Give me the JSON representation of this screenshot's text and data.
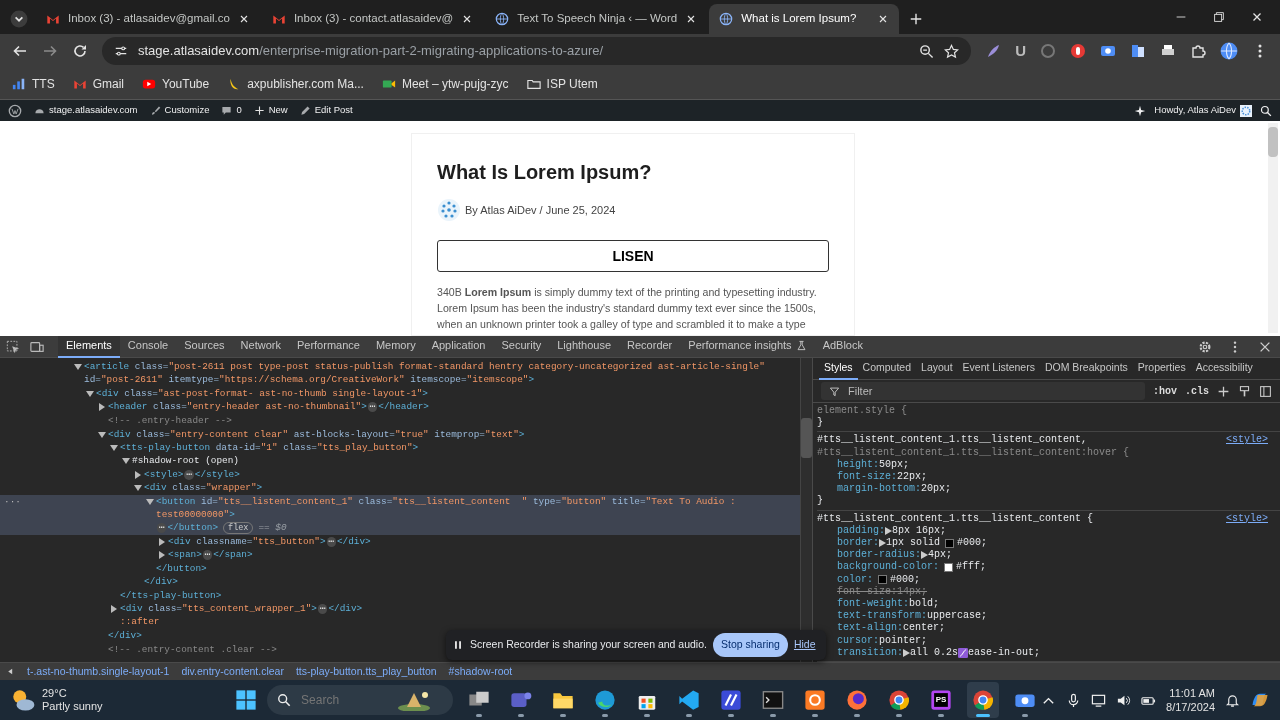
{
  "browser": {
    "tabs": [
      {
        "kind": "gmail",
        "title": "Inbox (3) - atlasaidev@gmail.co",
        "selected": false
      },
      {
        "kind": "gmail",
        "title": "Inbox (3) - contact.atlasaidev@",
        "selected": false
      },
      {
        "kind": "globe",
        "title": "Text To Speech Ninja ‹ — Word",
        "selected": false
      },
      {
        "kind": "globe",
        "title": "What is Lorem Ipsum?",
        "selected": true
      }
    ]
  },
  "toolbar": {
    "url_host": "stage.atlasaidev.com",
    "url_path": "/enterprise-migration-part-2-migrating-applications-to-azure/",
    "extensions": [
      {
        "kind": "feather"
      },
      {
        "kind": "letter",
        "glyph": "U"
      },
      {
        "kind": "ring"
      },
      {
        "kind": "hand"
      },
      {
        "kind": "record"
      },
      {
        "kind": "doc"
      },
      {
        "kind": "printer"
      },
      {
        "kind": "puzzle"
      }
    ]
  },
  "bookmarks": [
    {
      "kind": "bars",
      "label": "TTS"
    },
    {
      "kind": "gmail",
      "label": "Gmail"
    },
    {
      "kind": "youtube",
      "label": "YouTube"
    },
    {
      "kind": "banana",
      "label": "axpublisher.com Ma..."
    },
    {
      "kind": "meet",
      "label": "Meet – ytw-pujg-zyc"
    },
    {
      "kind": "folder",
      "label": "ISP Utem"
    }
  ],
  "admin_bar": {
    "items": [
      {
        "kind": "gauge",
        "label": "stage.atlasaidev.com"
      },
      {
        "kind": "brush",
        "label": "Customize"
      },
      {
        "kind": "comment",
        "label": "0"
      },
      {
        "kind": "plus",
        "label": "New"
      },
      {
        "kind": "pencil",
        "label": "Edit Post"
      }
    ],
    "greeting": "Howdy, Atlas AiDev"
  },
  "post": {
    "title": "What Is Lorem Ipsum?",
    "byline": "By Atlas AiDev / June 25, 2024",
    "listen_button": "LISEN",
    "body": "340B **Lorem Ipsum** is simply dummy text of the printing and typesetting industry. Lorem Ipsum has been the industry's standard dummy text ever since the 1500s, when an unknown printer took a galley of type and scrambled it to make a type"
  },
  "devtools": {
    "tabs": [
      {
        "label": "Elements",
        "selected": true
      },
      {
        "label": "Console",
        "selected": false
      },
      {
        "label": "Sources",
        "selected": false
      },
      {
        "label": "Network",
        "selected": false
      },
      {
        "label": "Performance",
        "selected": false
      },
      {
        "label": "Memory",
        "selected": false
      },
      {
        "label": "Application",
        "selected": false
      },
      {
        "label": "Security",
        "selected": false
      },
      {
        "label": "Lighthouse",
        "selected": false
      },
      {
        "label": "Recorder",
        "selected": false
      },
      {
        "label": "Performance insights",
        "selected": false,
        "experimental": true
      },
      {
        "label": "AdBlock",
        "selected": false
      }
    ],
    "dom": [
      {
        "kind": "open",
        "selected": false,
        "parts": [
          {
            "kind": "tag",
            "text": "<article"
          },
          {
            "kind": "attr",
            "text": " class="
          },
          {
            "kind": "value",
            "text": "\"post-2611 post type-post status-publish format-standard hentry category-uncategorized ast-article-single\""
          },
          {
            "kind": "attr",
            "text": " id="
          },
          {
            "kind": "value",
            "text": "\"post-2611\""
          },
          {
            "kind": "attr",
            "text": " itemtype="
          },
          {
            "kind": "value",
            "text": "\"https://schema.org/CreativeWork\""
          },
          {
            "kind": "attr",
            "text": " itemscope="
          },
          {
            "kind": "value",
            "text": "\"itemscope\""
          },
          {
            "kind": "tag",
            "text": ">"
          }
        ],
        "children": [
          {
            "kind": "open",
            "selected": false,
            "parts": [
              {
                "kind": "tag",
                "text": "<div"
              },
              {
                "kind": "attr",
                "text": " class="
              },
              {
                "kind": "value",
                "text": "\"ast-post-format- ast-no-thumb single-layout-1\""
              },
              {
                "kind": "tag",
                "text": ">"
              }
            ],
            "children": [
              {
                "kind": "closed",
                "selected": false,
                "parts": [
                  {
                    "kind": "tag",
                    "text": "<header"
                  },
                  {
                    "kind": "attr",
                    "text": " class="
                  },
                  {
                    "kind": "value",
                    "text": "\"entry-header ast-no-thumbnail\""
                  },
                  {
                    "kind": "tag",
                    "text": ">"
                  },
                  {
                    "kind": "ellipsis",
                    "text": "⋯"
                  },
                  {
                    "kind": "tag",
                    "text": "</header>"
                  }
                ]
              },
              {
                "kind": "leaf",
                "selected": false,
                "parts": [
                  {
                    "kind": "comment",
                    "text": "<!-- .entry-header -->"
                  }
                ]
              },
              {
                "kind": "open",
                "selected": false,
                "parts": [
                  {
                    "kind": "tag",
                    "text": "<div"
                  },
                  {
                    "kind": "attr",
                    "text": " class="
                  },
                  {
                    "kind": "value",
                    "text": "\"entry-content clear\""
                  },
                  {
                    "kind": "attr",
                    "text": " ast-blocks-layout="
                  },
                  {
                    "kind": "value",
                    "text": "\"true\""
                  },
                  {
                    "kind": "attr",
                    "text": " itemprop="
                  },
                  {
                    "kind": "value",
                    "text": "\"text\""
                  },
                  {
                    "kind": "tag",
                    "text": ">"
                  }
                ],
                "children": [
                  {
                    "kind": "open",
                    "selected": false,
                    "parts": [
                      {
                        "kind": "tag",
                        "text": "<tts-play-button"
                      },
                      {
                        "kind": "attr",
                        "text": " data-id="
                      },
                      {
                        "kind": "value",
                        "text": "\"1\""
                      },
                      {
                        "kind": "attr",
                        "text": " class="
                      },
                      {
                        "kind": "value",
                        "text": "\"tts_play_button\""
                      },
                      {
                        "kind": "tag",
                        "text": ">"
                      }
                    ],
                    "children": [
                      {
                        "kind": "open",
                        "selected": false,
                        "parts": [
                          {
                            "kind": "text",
                            "text": "#shadow-root (open)"
                          }
                        ],
                        "children": [
                          {
                            "kind": "closed",
                            "selected": false,
                            "parts": [
                              {
                                "kind": "tag",
                                "text": "<style>"
                              },
                              {
                                "kind": "ellipsis",
                                "text": "⋯"
                              },
                              {
                                "kind": "tag",
                                "text": "</style>"
                              }
                            ]
                          },
                          {
                            "kind": "open",
                            "selected": false,
                            "parts": [
                              {
                                "kind": "tag",
                                "text": "<div"
                              },
                              {
                                "kind": "attr",
                                "text": " class="
                              },
                              {
                                "kind": "value",
                                "text": "\"wrapper\""
                              },
                              {
                                "kind": "tag",
                                "text": ">"
                              }
                            ],
                            "children": [
                              {
                                "kind": "open",
                                "selected": true,
                                "gutter": "···",
                                "parts": [
                                  {
                                    "kind": "tag",
                                    "text": "<button"
                                  },
                                  {
                                    "kind": "attr",
                                    "text": " id="
                                  },
                                  {
                                    "kind": "value",
                                    "text": "\"tts__listent_content_1\""
                                  },
                                  {
                                    "kind": "attr",
                                    "text": " class="
                                  },
                                  {
                                    "kind": "value",
                                    "text": "\"tts__listent_content  \""
                                  },
                                  {
                                    "kind": "attr",
                                    "text": " type="
                                  },
                                  {
                                    "kind": "value",
                                    "text": "\"button\""
                                  },
                                  {
                                    "kind": "attr",
                                    "text": " title="
                                  },
                                  {
                                    "kind": "value",
                                    "text": "\"Text To Audio : test00000000\""
                                  },
                                  {
                                    "kind": "tag",
                                    "text": ">"
                                  }
                                ],
                                "tail": [
                                  {
                                    "kind": "ellipsis",
                                    "text": "⋯"
                                  },
                                  {
                                    "kind": "tag",
                                    "text": "</button>"
                                  },
                                  {
                                    "kind": "badge",
                                    "text": "flex"
                                  },
                                  {
                                    "kind": "dim",
                                    "text": "== $0"
                                  }
                                ],
                                "children": [
                                  {
                                    "kind": "closed",
                                    "selected": false,
                                    "parts": [
                                      {
                                        "kind": "tag",
                                        "text": "<div"
                                      },
                                      {
                                        "kind": "attr",
                                        "text": " classname="
                                      },
                                      {
                                        "kind": "value",
                                        "text": "\"tts_button\""
                                      },
                                      {
                                        "kind": "tag",
                                        "text": ">"
                                      },
                                      {
                                        "kind": "ellipsis",
                                        "text": "⋯"
                                      },
                                      {
                                        "kind": "tag",
                                        "text": "</div>"
                                      }
                                    ]
                                  },
                                  {
                                    "kind": "closed",
                                    "selected": false,
                                    "parts": [
                                      {
                                        "kind": "tag",
                                        "text": "<span>"
                                      },
                                      {
                                        "kind": "ellipsis",
                                        "text": "⋯"
                                      },
                                      {
                                        "kind": "tag",
                                        "text": "</span>"
                                      }
                                    ]
                                  }
                                ],
                                "close": [
                                  {
                                    "kind": "tag",
                                    "text": "</button>"
                                  }
                                ]
                              }
                            ],
                            "close": [
                              {
                                "kind": "tag",
                                "text": "</div>"
                              }
                            ]
                          }
                        ]
                      }
                    ],
                    "close": [
                      {
                        "kind": "tag",
                        "text": "</tts-play-button>"
                      }
                    ]
                  },
                  {
                    "kind": "closed",
                    "selected": false,
                    "parts": [
                      {
                        "kind": "tag",
                        "text": "<div"
                      },
                      {
                        "kind": "attr",
                        "text": " class="
                      },
                      {
                        "kind": "value",
                        "text": "\"tts_content_wrapper_1\""
                      },
                      {
                        "kind": "tag",
                        "text": ">"
                      },
                      {
                        "kind": "ellipsis",
                        "text": "⋯"
                      },
                      {
                        "kind": "tag",
                        "text": "</div>"
                      }
                    ]
                  },
                  {
                    "kind": "leaf",
                    "selected": false,
                    "parts": [
                      {
                        "kind": "pseudo",
                        "text": "::after"
                      }
                    ]
                  }
                ],
                "close": [
                  {
                    "kind": "tag",
                    "text": "</div>"
                  }
                ]
              },
              {
                "kind": "leaf",
                "selected": false,
                "parts": [
                  {
                    "kind": "comment",
                    "text": "<!-- .entry-content .clear -->"
                  }
                ]
              }
            ]
          }
        ]
      }
    ],
    "breadcrumbs": [
      "t-.ast-no-thumb.single-layout-1",
      "div.entry-content.clear",
      "tts-play-button.tts_play_button",
      "#shadow-root"
    ],
    "styles": {
      "tabs": [
        {
          "label": "Styles",
          "selected": true
        },
        {
          "label": "Computed",
          "selected": false
        },
        {
          "label": "Layout",
          "selected": false
        },
        {
          "label": "Event Listeners",
          "selected": false
        },
        {
          "label": "DOM Breakpoints",
          "selected": false
        },
        {
          "label": "Properties",
          "selected": false
        },
        {
          "label": "Accessibility",
          "selected": false
        }
      ],
      "filter_placeholder": "Filter",
      "toggles": [
        ":hov",
        ".cls"
      ],
      "rules": [
        {
          "selectors": [
            {
              "text": "element.style {",
              "matched": false
            }
          ],
          "close": "}"
        },
        {
          "selectors": [
            {
              "text": "#tts__listent_content_1.tts__listent_content,",
              "matched": true
            },
            {
              "text": "#tts__listent_content_1.tts__listent_content:hover {",
              "matched": false
            }
          ],
          "source": "<style>",
          "props": [
            {
              "name": "height:",
              "value": "50px;",
              "struck": false,
              "expandable": false
            },
            {
              "name": "font-size:",
              "value": "22px;",
              "struck": false,
              "expandable": false
            },
            {
              "name": "margin-bottom:",
              "value": "20px;",
              "struck": false,
              "expandable": false
            }
          ],
          "close": "}"
        },
        {
          "selectors": [
            {
              "text": "#tts__listent_content_1.tts__listent_content {",
              "matched": true
            }
          ],
          "source": "<style>",
          "props": [
            {
              "name": "padding:",
              "value": "8px 16px;",
              "struck": false,
              "expandable": true
            },
            {
              "name": "border:",
              "prefix": "1px solid",
              "swatch": {
                "kind": "color",
                "color": "#000000"
              },
              "value": "#000;",
              "struck": false,
              "expandable": true
            },
            {
              "name": "border-radius:",
              "value": "4px;",
              "struck": false,
              "expandable": true
            },
            {
              "name": "background-color:",
              "swatch": {
                "kind": "color",
                "color": "#ffffff"
              },
              "value": "#fff;",
              "struck": false,
              "expandable": false
            },
            {
              "name": "color:",
              "swatch": {
                "kind": "color",
                "color": "#000000"
              },
              "value": "#000;",
              "struck": false,
              "expandable": false
            },
            {
              "name": "font-size:",
              "value": "14px;",
              "struck": true,
              "expandable": false
            },
            {
              "name": "font-weight:",
              "value": "bold;",
              "struck": false,
              "expandable": false
            },
            {
              "name": "text-transform:",
              "value": "uppercase;",
              "struck": false,
              "expandable": false
            },
            {
              "name": "text-align:",
              "value": "center;",
              "struck": false,
              "expandable": false
            },
            {
              "name": "cursor:",
              "value": "pointer;",
              "struck": false,
              "expandable": false
            },
            {
              "name": "transition:",
              "prefix": "all 0.2s",
              "swatch": {
                "kind": "easing"
              },
              "value": "ease-in-out;",
              "struck": false,
              "expandable": true
            }
          ]
        }
      ]
    }
  },
  "share_notice": {
    "message": "Screen Recorder is sharing your screen and audio.",
    "stop_button": "Stop sharing",
    "hide_link": "Hide"
  },
  "taskbar": {
    "weather": {
      "temperature": "29°C",
      "condition": "Partly sunny"
    },
    "search_placeholder": "Search",
    "apps": [
      {
        "kind": "taskview",
        "active": false
      },
      {
        "kind": "chat",
        "active": false
      },
      {
        "kind": "files",
        "active": false
      },
      {
        "kind": "edge",
        "active": false
      },
      {
        "kind": "store",
        "active": false
      },
      {
        "kind": "code",
        "active": false
      },
      {
        "kind": "slant",
        "active": false
      },
      {
        "kind": "terminal",
        "active": false
      },
      {
        "kind": "server",
        "active": false
      },
      {
        "kind": "fox",
        "active": false
      },
      {
        "kind": "wheel",
        "active": false
      },
      {
        "kind": "ide",
        "glyph": "PS",
        "active": false
      },
      {
        "kind": "wheel",
        "active": true
      },
      {
        "kind": "camera",
        "active": false
      }
    ],
    "time": "11:01 AM",
    "date": "8/17/2024"
  }
}
